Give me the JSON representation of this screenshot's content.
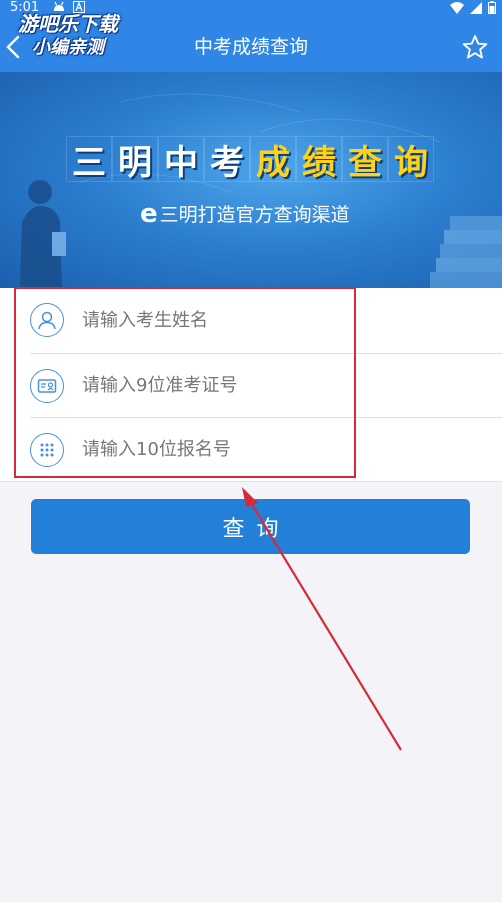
{
  "status_bar": {
    "time": "5:01",
    "icons": [
      "android-icon",
      "a-notification-icon",
      "wifi-icon",
      "signal-icon",
      "battery-icon"
    ]
  },
  "watermark": {
    "line1": "游吧乐下载",
    "line2": "小编亲测"
  },
  "app_bar": {
    "title": "中考成绩查询",
    "back_icon": "chevron-left-icon",
    "favorite_icon": "star-outline-icon"
  },
  "banner": {
    "title_white": [
      "三",
      "明",
      "中",
      "考"
    ],
    "title_gold": [
      "成",
      "绩",
      "查",
      "询"
    ],
    "logo_letter": "e",
    "subtitle": "三明打造官方查询渠道"
  },
  "form": {
    "fields": [
      {
        "placeholder": "请输入考生姓名",
        "value": "",
        "icon": "user-icon"
      },
      {
        "placeholder": "请输入9位准考证号",
        "value": "",
        "icon": "id-card-icon"
      },
      {
        "placeholder": "请输入10位报名号",
        "value": "",
        "icon": "keypad-icon"
      }
    ]
  },
  "actions": {
    "query_label": "查询"
  },
  "colors": {
    "app_bar": "#2f86e6",
    "button": "#2280d8",
    "highlight": "#d62a3a",
    "icon": "#4a90d9",
    "gold": "#ffd21a"
  }
}
